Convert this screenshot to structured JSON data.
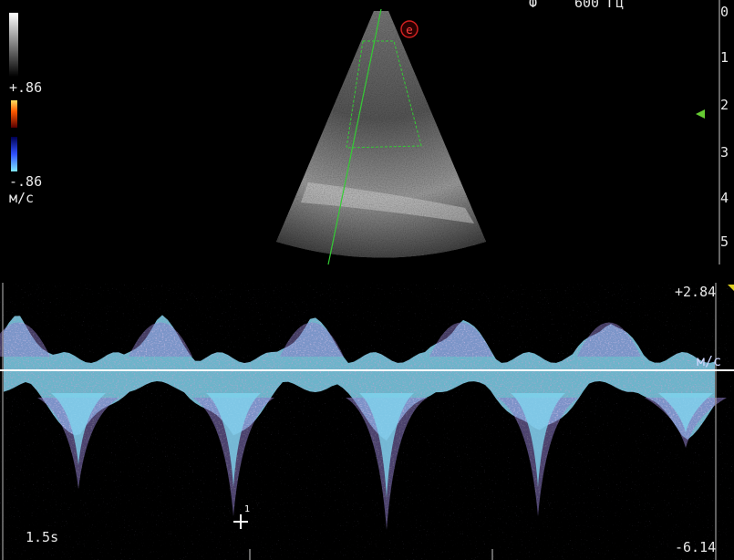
{
  "header": {
    "frequency_label": "Ф",
    "frequency_value": "600 Гц"
  },
  "color_scale": {
    "max_label": "+.86",
    "min_label": "-.86",
    "unit": "м/с"
  },
  "depth_scale": {
    "ticks": [
      "0",
      "1",
      "2",
      "3",
      "4",
      "5"
    ]
  },
  "spectral": {
    "top_velocity": "+2.84",
    "bottom_velocity": "-6.14",
    "unit": "м/с",
    "sweep_time": "1.5s",
    "cursor_marker": "1"
  },
  "colors": {
    "spectrum": "#7fd4ee",
    "spectrum_edge": "#8a78c8",
    "baseline": "#ffffff",
    "sample_line": "#33cc33",
    "focus_marker": "#66cc33"
  }
}
